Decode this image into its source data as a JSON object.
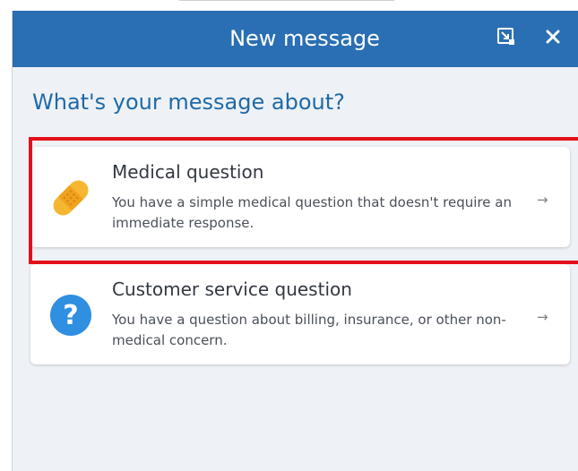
{
  "dialog": {
    "title": "New message",
    "header_color": "#2a6fb3",
    "popout_icon": "popout-icon",
    "close_icon": "close-icon"
  },
  "heading": "What's your message about?",
  "options": [
    {
      "title": "Medical question",
      "description": "You have a simple medical question that doesn't require an immediate response.",
      "icon": "bandage-icon",
      "arrow": "→",
      "highlighted": true
    },
    {
      "title": "Customer service question",
      "description": "You have a question about billing, insurance, or other non-medical concern.",
      "icon": "question-mark-icon",
      "arrow": "→",
      "highlighted": false
    }
  ],
  "colors": {
    "accent": "#1e6aa8",
    "highlight": "#e3101a",
    "bandage": "#f5b731",
    "question_circle": "#2f8fe0"
  }
}
